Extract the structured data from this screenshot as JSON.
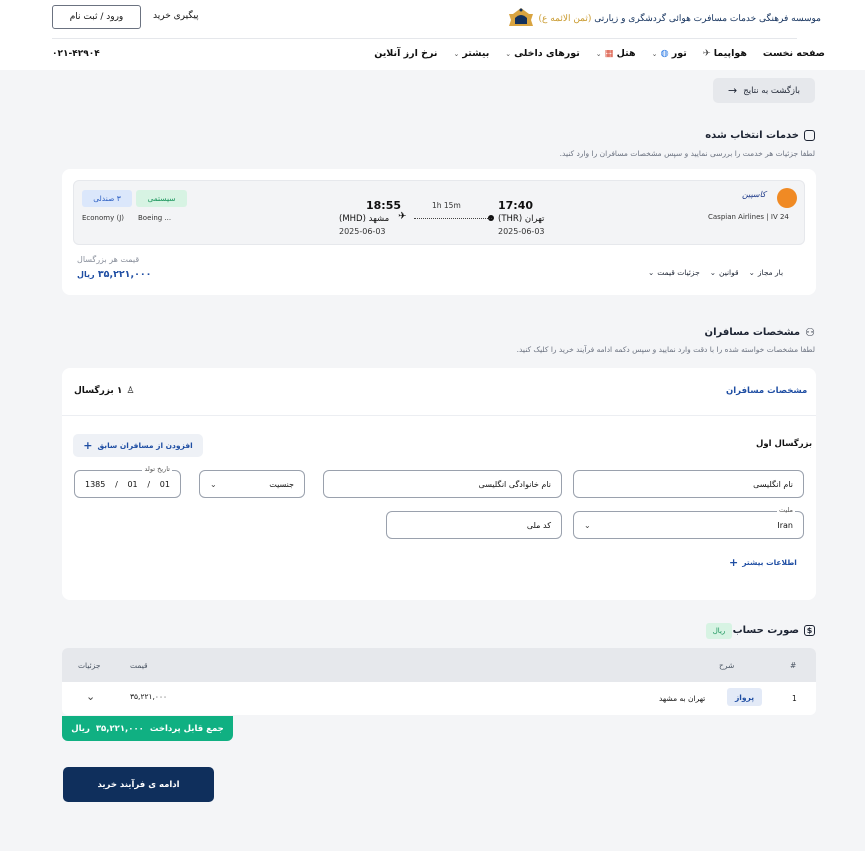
{
  "header": {
    "logo_text_main": "موسسه فرهنگی خدمات مسافرت هوائی گردشگری و زیارتی",
    "logo_text_gold": "(ثمن الائمه ع)",
    "login_label": "ورود / ثبت نام",
    "track_label": "پیگیری خرید",
    "phone": "۰۲۱-۴۲۹۰۴",
    "nav": [
      {
        "label": "صفحه نخست"
      },
      {
        "label": "هواپیما",
        "icon": "airplane-icon"
      },
      {
        "label": "تور",
        "icon": "globe-icon"
      },
      {
        "label": "هتل",
        "icon": "hotel-icon"
      },
      {
        "label": "تورهای داخلی"
      },
      {
        "label": "بیشتر"
      },
      {
        "label": "نرخ ارز آنلاین"
      }
    ]
  },
  "back_label": "بازگشت به نتایج",
  "services": {
    "title": "خدمات انتخاب شده",
    "subtitle": "لطفا جزئیات هر خدمت را بررسی نمایید و سپس مشخصات مسافران را وارد کنید."
  },
  "flight": {
    "airline_script": "کاسپین",
    "airline_name": "Caspian Airlines",
    "flight_no": "IV 24",
    "dep_time": "17:40",
    "dep_city": "تهران (THR)",
    "dep_date": "2025-06-03",
    "arr_time": "18:55",
    "arr_city": "مشهد (MHD)",
    "arr_date": "2025-06-03",
    "duration": "1h 15m",
    "system_badge": "سیستمی",
    "seats_badge": "۳ صندلی",
    "aircraft": "Boeing ...",
    "cabin": "Economy (J)",
    "price_label": "قیمت هر بزرگسال",
    "price_value": "۳۵,۲۲۱,۰۰۰",
    "price_unit": "ریال",
    "links": [
      "بار مجاز",
      "قوانین",
      "جزئیات قیمت"
    ]
  },
  "passengers": {
    "title": "مشخصات مسافران",
    "subtitle": "لطفا مشخصات خواسته شده را با دقت وارد نمایید و سپس دکمه ادامه فرآیند خرید را کلیک کنید.",
    "tab": "مشخصات مسافران",
    "count": "۱ بزرگسال",
    "adult_title": "بزرگسال اول",
    "add_prev": "افزودن از مسافران سابق",
    "first_name_ph": "نام انگلیسی",
    "last_name_ph": "نام خانوادگی انگلیسی",
    "gender_ph": "جنسیت",
    "birth_label": "تاریخ تولد",
    "birth_year": "1385",
    "birth_month": "01",
    "birth_day": "01",
    "nationality_label": "ملیت",
    "nationality_value": "Iran",
    "national_id_ph": "کد ملی",
    "more_info": "اطلاعات بیشتر"
  },
  "invoice": {
    "title": "صورت حساب",
    "currency_badge": "ریال",
    "columns": {
      "num": "#",
      "desc": "شرح",
      "price": "قیمت",
      "details": "جزئیات"
    },
    "rows": [
      {
        "num": "1",
        "type": "پرواز",
        "desc": "تهران به مشهد",
        "price": "۳۵,۲۲۱,۰۰۰"
      }
    ],
    "total_label": "جمع قابل پرداخت",
    "total_value": "۳۵,۲۲۱,۰۰۰",
    "total_unit": "ریال"
  },
  "continue_label": "ادامه ی فرآیند خرید",
  "colors": {
    "primary": "#0f2f5c",
    "accent_blue": "#1f4ea3",
    "success": "#10b082"
  }
}
